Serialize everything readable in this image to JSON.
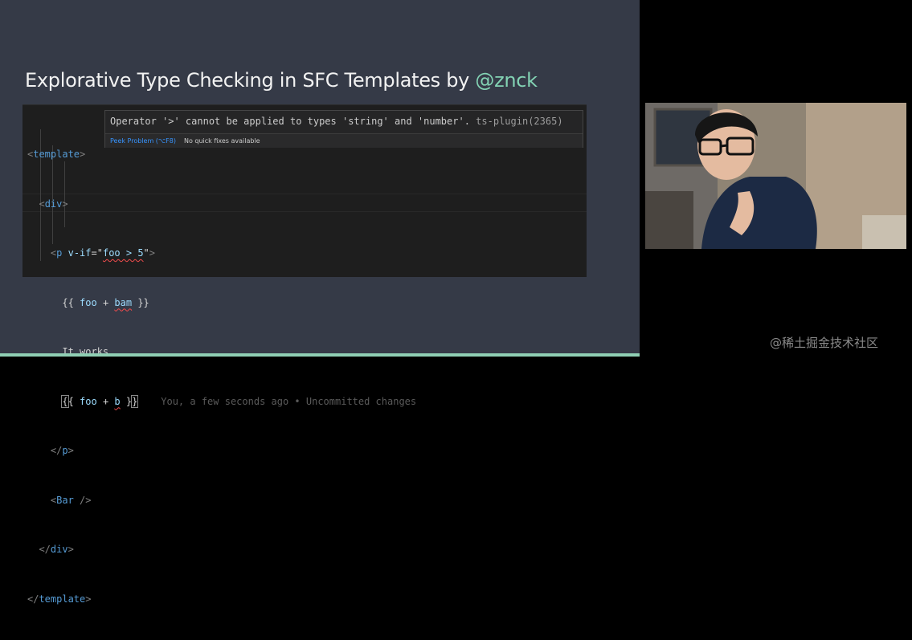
{
  "slide": {
    "title": "Explorative Type Checking in SFC Templates by ",
    "title_handle": "@znck",
    "accent_color": "#83d3b4",
    "background_color": "#353a47"
  },
  "code": {
    "lines": {
      "l1": {
        "t1": "<",
        "t2": "template",
        "t3": ">"
      },
      "l2": {
        "t1": "<",
        "t2": "div",
        "t3": ">"
      },
      "l3": {
        "t1": "<",
        "t2": "p",
        "t3": " ",
        "t4": "v-if",
        "t5": "=\"",
        "t6": "foo > 5",
        "t7": "\"",
        "t8": ">"
      },
      "l4": {
        "t1": "{{ ",
        "t2": "foo",
        "t3": " + ",
        "t4": "bam",
        "t5": " }}"
      },
      "l5": {
        "t1": "It works."
      },
      "l6": {
        "t1": "{",
        "t2": "{ ",
        "t3": "foo",
        "t4": " + ",
        "t5": "b",
        "t6": " }",
        "t7": "}",
        "ghost": "You, a few seconds ago • Uncommitted changes"
      },
      "l7": {
        "t1": "</",
        "t2": "p",
        "t3": ">"
      },
      "l8": {
        "t1": "<",
        "t2": "Bar",
        "t3": " />"
      },
      "l9": {
        "t1": "</",
        "t2": "div",
        "t3": ">"
      },
      "l10": {
        "t1": "</",
        "t2": "template",
        "t3": ">"
      }
    }
  },
  "hover": {
    "message": "Operator '>' cannot be applied to types 'string' and 'number'.",
    "source": "ts-plugin(2365)",
    "peek_problem": "Peek Problem (⌥F8)",
    "no_fixes": "No quick fixes available"
  },
  "watermark": "@稀土掘金技术社区"
}
